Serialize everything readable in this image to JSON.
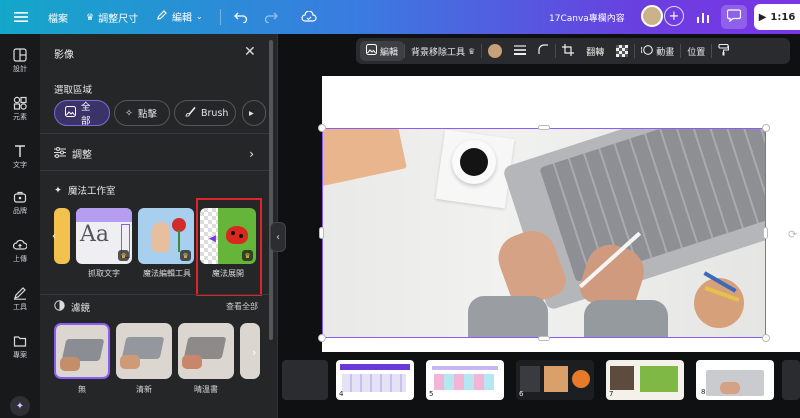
{
  "topbar": {
    "menu_icon": "hamburger-icon",
    "file_label": "檔案",
    "resize_label": "調整尺寸",
    "edit_label": "編輯",
    "project_title": "17Canva專欄內容",
    "play_time": "1:16"
  },
  "rail": {
    "items": [
      {
        "label": "設計",
        "icon": "layout-icon"
      },
      {
        "label": "元素",
        "icon": "shapes-icon"
      },
      {
        "label": "文字",
        "icon": "text-icon"
      },
      {
        "label": "品牌",
        "icon": "brand-icon"
      },
      {
        "label": "上傳",
        "icon": "cloud-upload-icon"
      },
      {
        "label": "工具",
        "icon": "pen-icon"
      },
      {
        "label": "專案",
        "icon": "folder-icon"
      }
    ]
  },
  "panel": {
    "title": "影像",
    "select_area_label": "選取區域",
    "select_options": [
      {
        "label": "全部",
        "active": true
      },
      {
        "label": "點擊",
        "active": false
      },
      {
        "label": "Brush",
        "active": false
      }
    ],
    "adjust_label": "調整",
    "magic_studio_label": "魔法工作室",
    "magic_tools": [
      {
        "label": "抓取文字"
      },
      {
        "label": "魔法編輯工具"
      },
      {
        "label": "魔法展開"
      }
    ],
    "filters_label": "濾鏡",
    "see_all_label": "查看全部",
    "filters": [
      {
        "label": "無"
      },
      {
        "label": "清新"
      },
      {
        "label": "晴溫書"
      }
    ]
  },
  "context_toolbar": {
    "edit_label": "編輯",
    "bg_remove_label": "背景移除工具",
    "swatch_color": "#c8a07a",
    "flip_label": "翻轉",
    "animate_label": "動畫",
    "position_label": "位置"
  },
  "filmstrip": {
    "pages": [
      "4",
      "5",
      "6",
      "7",
      "8"
    ]
  },
  "colors": {
    "accent": "#8b5cf6",
    "highlight_red": "#e0232b"
  }
}
